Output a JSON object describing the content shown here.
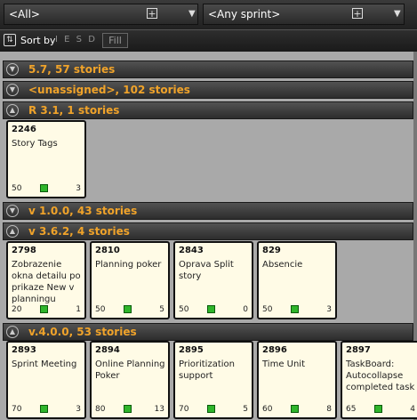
{
  "filters": {
    "release_value": "<All>",
    "sprint_value": "<Any sprint>"
  },
  "sortbar": {
    "sort_label": "Sort by",
    "keys": [
      "I",
      "E",
      "S",
      "D",
      "R"
    ],
    "fill_label": "Fill"
  },
  "lanes": [
    {
      "title": "5.7, 57 stories",
      "expanded": false,
      "cards": []
    },
    {
      "title": "<unassigned>, 102 stories",
      "expanded": false,
      "cards": []
    },
    {
      "title": "R 3.1, 1 stories",
      "expanded": true,
      "cards": [
        {
          "id": "2246",
          "title": "Story Tags",
          "estimate": "50",
          "tasks": "3"
        }
      ]
    },
    {
      "title": "v 1.0.0, 43 stories",
      "expanded": false,
      "cards": []
    },
    {
      "title": "v 3.6.2, 4 stories",
      "expanded": true,
      "cards": [
        {
          "id": "2798",
          "title": "Zobrazenie okna detailu po prikaze New v planningu",
          "estimate": "20",
          "tasks": "1"
        },
        {
          "id": "2810",
          "title": "Planning poker",
          "estimate": "50",
          "tasks": "5"
        },
        {
          "id": "2843",
          "title": "Oprava Split story",
          "estimate": "50",
          "tasks": "0"
        },
        {
          "id": "829",
          "title": "Absencie",
          "estimate": "50",
          "tasks": "3"
        }
      ]
    },
    {
      "title": "v.4.0.0, 53 stories",
      "expanded": true,
      "cards": [
        {
          "id": "2893",
          "title": "Sprint Meeting",
          "estimate": "70",
          "tasks": "3"
        },
        {
          "id": "2894",
          "title": "Online Planning Poker",
          "estimate": "80",
          "tasks": "13"
        },
        {
          "id": "2895",
          "title": "Prioritization support",
          "estimate": "70",
          "tasks": "5"
        },
        {
          "id": "2896",
          "title": "Time Unit",
          "estimate": "60",
          "tasks": "8"
        },
        {
          "id": "2897",
          "title": "TaskBoard: Autocollapse completed task",
          "estimate": "65",
          "tasks": "4"
        }
      ]
    }
  ],
  "colors": {
    "lane_title": "#f0a32a",
    "status_green": "#2fb52b",
    "card_bg": "#fffbe6"
  }
}
